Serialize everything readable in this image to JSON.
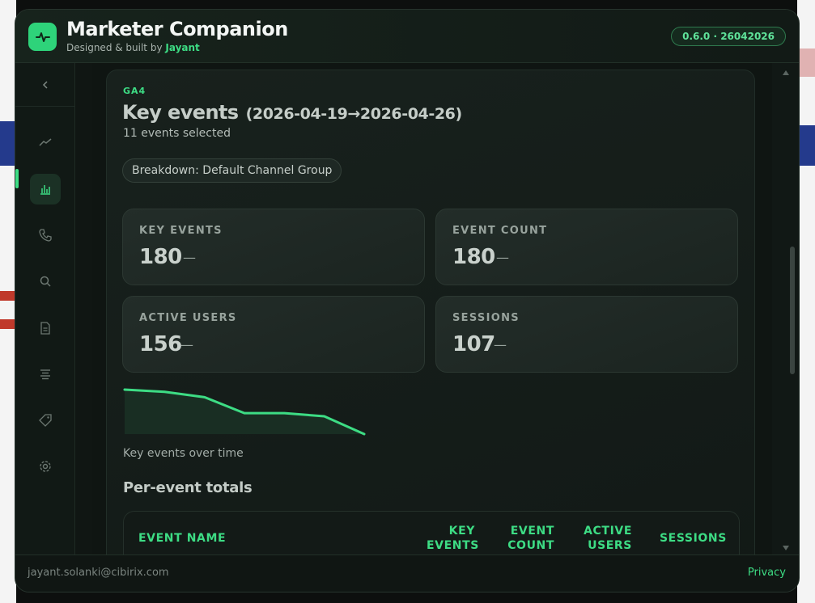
{
  "app": {
    "title": "Marketer Companion",
    "subtitle_prefix": "Designed & built by",
    "author": "Jayant",
    "version": "0.6.0 · 26042026"
  },
  "sidebar": {
    "items": [
      {
        "icon": "trend-line-icon",
        "active": false
      },
      {
        "icon": "bar-chart-icon",
        "active": true
      },
      {
        "icon": "phone-icon",
        "active": false
      },
      {
        "icon": "search-icon",
        "active": false
      },
      {
        "icon": "document-icon",
        "active": false
      },
      {
        "icon": "align-center-icon",
        "active": false
      },
      {
        "icon": "tag-icon",
        "active": false
      },
      {
        "icon": "gear-icon",
        "active": false
      }
    ]
  },
  "report": {
    "source": "GA4",
    "title": "Key events",
    "date_range": "(2026-04-19→2026-04-26)",
    "selection_summary": "11 events selected",
    "breakdown_chip": "Breakdown: Default Channel Group",
    "metrics": [
      {
        "label": "KEY EVENTS",
        "value": "180",
        "delta": "—"
      },
      {
        "label": "EVENT COUNT",
        "value": "180",
        "delta": "—"
      },
      {
        "label": "ACTIVE USERS",
        "value": "156",
        "delta": "—"
      },
      {
        "label": "SESSIONS",
        "value": "107",
        "delta": "—"
      }
    ],
    "sparkline_caption": "Key events over time",
    "table_title": "Per-event totals",
    "table_columns": [
      [
        "EVENT NAME"
      ],
      [
        "KEY",
        "EVENTS"
      ],
      [
        "EVENT",
        "COUNT"
      ],
      [
        "ACTIVE",
        "USERS"
      ],
      [
        "SESSIONS"
      ]
    ]
  },
  "sparkline": {
    "values": [
      1.0,
      0.95,
      0.83,
      0.47,
      0.47,
      0.4,
      0.0
    ],
    "line_color": "#3ddc84"
  },
  "footer": {
    "email": "jayant.solanki@cibirix.com",
    "privacy_label": "Privacy"
  },
  "colors": {
    "accent": "#3ddc84",
    "background": "#0f1512"
  }
}
